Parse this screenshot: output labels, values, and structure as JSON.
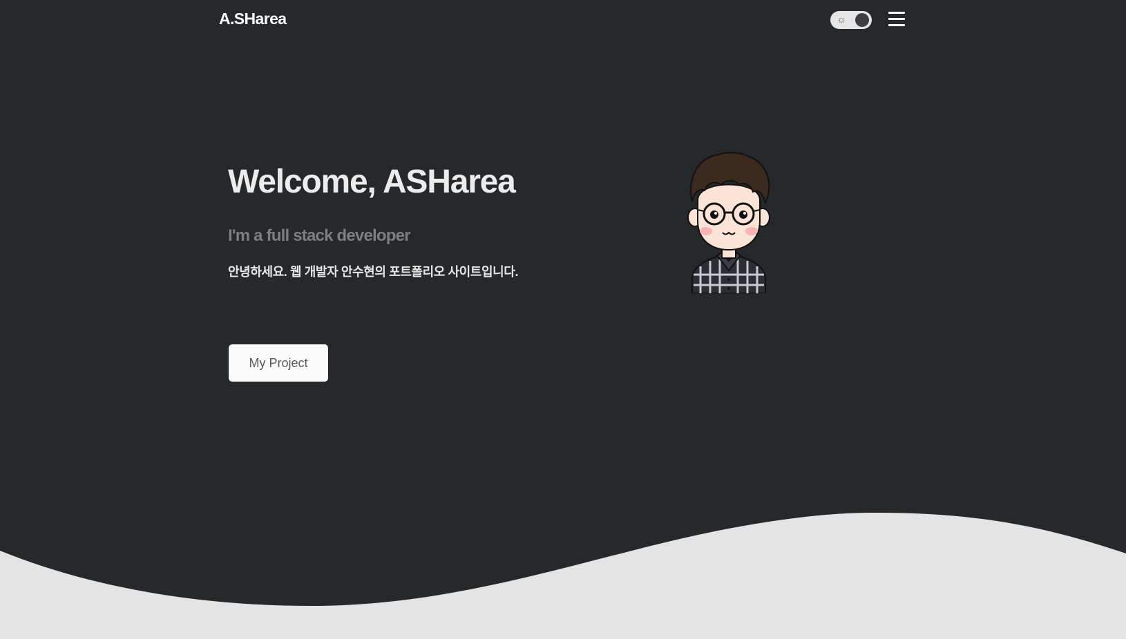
{
  "header": {
    "brand": "A.SHarea",
    "theme_toggle_icon": "sun-icon",
    "menu_icon": "hamburger-menu-icon"
  },
  "hero": {
    "title": "Welcome, ASHarea",
    "subtitle": "I'm a full stack developer",
    "intro": "안녕하세요. 웹 개발자 안수현의 포트폴리오 사이트입니다.",
    "cta_label": "My Project",
    "avatar_icon": "developer-avatar-illustration"
  },
  "colors": {
    "background": "#26292c",
    "wave": "#e4e4e4",
    "title": "#ececec",
    "subtitle": "#7b7e82",
    "button_bg": "#fafafa",
    "button_text": "#555a60"
  }
}
